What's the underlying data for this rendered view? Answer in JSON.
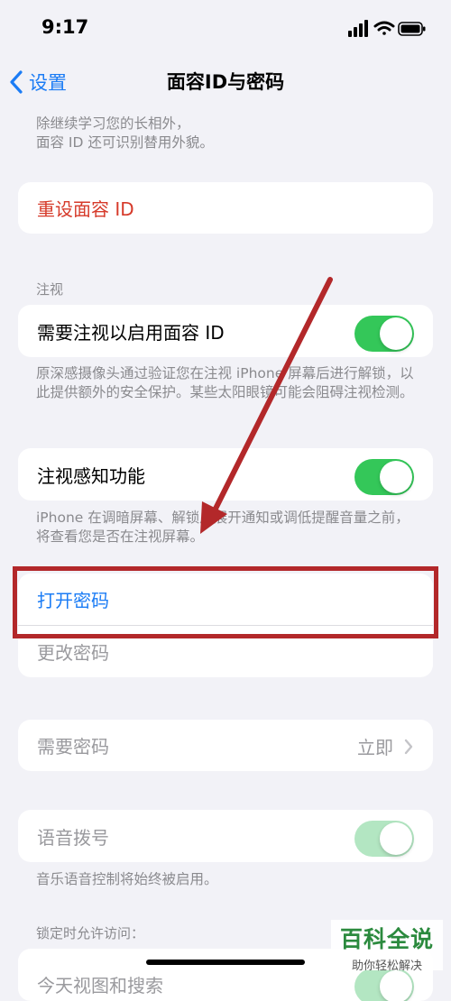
{
  "status": {
    "time": "9:17"
  },
  "nav": {
    "back_label": "设置",
    "title": "面容ID与密码"
  },
  "top_footer": "除继续学习您的长相外，\n面容 ID 还可识别替用外貌。",
  "reset_face_id": "重设面容 ID",
  "attention_header": "注视",
  "require_attention": {
    "label": "需要注视以启用面容 ID",
    "on": true
  },
  "attention_footer": "原深感摄像头通过验证您在注视 iPhone 屏幕后进行解锁，以此提供额外的安全保护。某些太阳眼镜可能会阻碍注视检测。",
  "attention_aware": {
    "label": "注视感知功能",
    "on": true
  },
  "aware_footer": "iPhone 在调暗屏幕、解锁后展开通知或调低提醒音量之前，将查看您是否在注视屏幕。",
  "passcode": {
    "turn_on": "打开密码",
    "change": "更改密码"
  },
  "require_passcode": {
    "label": "需要密码",
    "value": "立即"
  },
  "voice_dial": {
    "label": "语音拨号",
    "on": true
  },
  "voice_footer": "音乐语音控制将始终被启用。",
  "locked_header": "锁定时允许访问：",
  "today_view": {
    "label": "今天视图和搜索"
  },
  "watermark": {
    "main": "百科全说",
    "sub": "助你轻松解决"
  },
  "colors": {
    "accent": "#1b7cf5",
    "destructive": "#d63a2a",
    "toggle_on": "#34c759",
    "annotation": "#b3282a"
  }
}
